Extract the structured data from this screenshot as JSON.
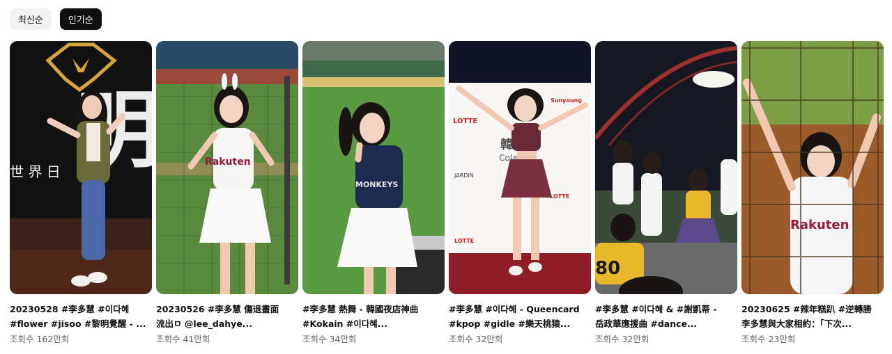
{
  "filters": [
    {
      "label": "최신순",
      "active": false
    },
    {
      "label": "인기순",
      "active": true
    }
  ],
  "videos": [
    {
      "title_line1": "20230528 #李多慧 #이다혜",
      "title_line2": "#flower #jisoo #黎明覺醒 - ...",
      "views": "조회수 162만회"
    },
    {
      "title_line1": "20230526 #李多慧 傷退畫面",
      "title_line2": "流出ㅁ @lee_dahye...",
      "views": "조회수 41만회"
    },
    {
      "title_line1": "#李多慧 熱舞 - 韓國夜店神曲",
      "title_line2": "#Kokain #이다혜...",
      "views": "조회수 34만회"
    },
    {
      "title_line1": "#李多慧 #이다혜 - Queencard",
      "title_line2": "#kpop #gidle #樂天桃猿...",
      "views": "조회수 32만회"
    },
    {
      "title_line1": "#李多慧 #이다혜 & #謝凱蒂 -",
      "title_line2": "岳政華應援曲 #dance...",
      "views": "조회수 32만회"
    },
    {
      "title_line1": "20230625 #辣年糕趴 #逆轉勝",
      "title_line2": "李多慧與大家相約：「下次...",
      "views": "조회수 23만회"
    }
  ],
  "thumb_text": {
    "t1_big": "明",
    "t1_sub": "世  界     日",
    "jersey_brand": "Rakuten",
    "monkeys": "MONKEYS",
    "banner_main": "韓",
    "banner_sub": "Cola",
    "lotte": "LOTTE",
    "jardin": "JARDIN",
    "sunyoung": "Sunyoung",
    "number": "80",
    "jersey_brand_lower": "Rakuten"
  }
}
